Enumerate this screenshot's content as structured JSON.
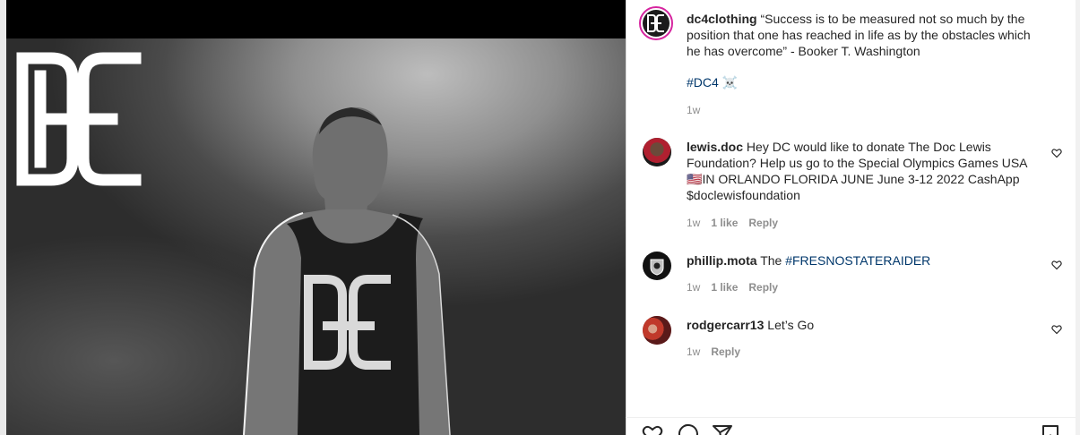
{
  "post": {
    "username": "dc4clothing",
    "caption": "“Success is to be measured not so much by the position that one has reached in life as by the obstacles which he has overcome” - Booker T. Washington",
    "hashtag": "#DC4",
    "emoji": "☠️",
    "time": "1w"
  },
  "comments": [
    {
      "username": "lewis.doc",
      "text_a": "Hey DC would like to donate The Doc Lewis Foundation? Help us go to the Special Olympics Games USA ",
      "flag": "🇺🇸",
      "text_b": "IN ORLANDO FLORIDA JUNE June 3-12 2022 CashApp $doclewisfoundation",
      "time": "1w",
      "likes": "1 like",
      "reply": "Reply"
    },
    {
      "username": "phillip.mota",
      "text_a": "The ",
      "hashtag": "#FRESNOSTATERAIDER",
      "time": "1w",
      "likes": "1 like",
      "reply": "Reply"
    },
    {
      "username": "rodgercarr13",
      "text_a": "Let’s Go",
      "time": "1w",
      "reply": "Reply"
    }
  ],
  "colors": {
    "link": "#00376b",
    "muted": "#8e8e8e",
    "story_ring": "#d6249f"
  },
  "icons": [
    "like-icon",
    "comment-icon",
    "share-icon",
    "save-icon",
    "heart-icon"
  ]
}
